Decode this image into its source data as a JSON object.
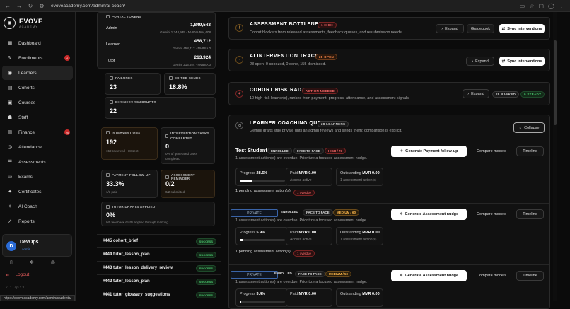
{
  "browser": {
    "url": "evoveacademy.com/admin/ai-coach/",
    "status_url": "https://evoveacademy.com/admin/students/"
  },
  "brand": {
    "name": "EVOVE",
    "sub": "ACADEMY"
  },
  "nav": [
    {
      "label": "Dashboard",
      "icon": "▦"
    },
    {
      "label": "Enrollments",
      "icon": "✎",
      "badge": "4"
    },
    {
      "label": "Learners",
      "icon": "◉",
      "active": true
    },
    {
      "label": "Cohorts",
      "icon": "▤"
    },
    {
      "label": "Courses",
      "icon": "▣"
    },
    {
      "label": "Staff",
      "icon": "☗"
    },
    {
      "label": "Finance",
      "icon": "▥",
      "badge": "20"
    },
    {
      "label": "Attendance",
      "icon": "◷"
    },
    {
      "label": "Assessments",
      "icon": "☰"
    },
    {
      "label": "Exams",
      "icon": "▭"
    },
    {
      "label": "Certificates",
      "icon": "✦"
    },
    {
      "label": "AI Coach",
      "icon": "✧"
    },
    {
      "label": "Reports",
      "icon": "↗"
    }
  ],
  "user": {
    "initial": "D",
    "name": "DevOps",
    "role": "admin"
  },
  "logout": "Logout",
  "version": "v1.1 · api 2.3",
  "tokens": {
    "label": "PORTAL TOKENS",
    "rows": [
      {
        "name": "Admin",
        "num": "1,849,543",
        "sub": "Gemini 1,344,935 · NVIDIA 504,608"
      },
      {
        "name": "Learner",
        "num": "458,712",
        "sub": "Gemini 458,712 · NVIDIA 0"
      },
      {
        "name": "Tutor",
        "num": "213,924",
        "sub": "Gemini 213,924 · NVIDIA 0"
      }
    ]
  },
  "stats": {
    "failures": {
      "label": "FAILURES",
      "value": "23"
    },
    "edited": {
      "label": "EDITED SENDS",
      "value": "18.8%"
    },
    "snapshots": {
      "label": "BUSINESS SNAPSHOTS",
      "value": "22"
    },
    "interventions": {
      "label": "INTERVENTIONS",
      "value": "192",
      "sub": "159 reviewed · 18 sent"
    },
    "tasks": {
      "label": "INTERVENTION TASKS COMPLETED",
      "value": "0",
      "sub": "0% of generated tasks completed"
    },
    "payment": {
      "label": "PAYMENT FOLLOW-UP",
      "value": "33.3%",
      "sub": "1/3 paid"
    },
    "reminder": {
      "label": "ASSESSMENT REMINDER",
      "value": "0/2",
      "sub": "0/2 submitted"
    },
    "tutor": {
      "label": "TUTOR DRAFTS APPLIED",
      "value": "0%",
      "sub": "0/0 feedback drafts applied through marking"
    }
  },
  "jobs": [
    {
      "name": "#445 cohort_brief",
      "status": "SUCCESS"
    },
    {
      "name": "#444 tutor_lesson_plan",
      "status": "SUCCESS"
    },
    {
      "name": "#443 tutor_lesson_delivery_review",
      "status": "SUCCESS"
    },
    {
      "name": "#442 tutor_lesson_plan",
      "status": "SUCCESS"
    },
    {
      "name": "#441 tutor_glossary_suggestions",
      "status": "SUCCESS"
    }
  ],
  "panels": {
    "bottlenecks": {
      "title": "ASSESSMENT BOTTLENECKS",
      "pill": "1 HIGH",
      "desc": "Cohort blockers from released assessments, feedback queues, and resubmission needs.",
      "expand": "Expand",
      "gradebook": "Gradebook",
      "sync": "Sync interventions"
    },
    "tracker": {
      "title": "AI INTERVENTION TRACKER",
      "pill": "28 OPEN",
      "desc": "28 open, 0 snoozed, 0 done, 155 dismissed.",
      "expand": "Expand",
      "sync": "Sync interventions"
    },
    "radar": {
      "title": "COHORT RISK RADAR",
      "pill": "ACTION NEEDED",
      "desc": "10 high-risk learner(s), ranked from payment, progress, attendance, and assessment signals.",
      "expand": "Expand",
      "ranked": "28 RANKED",
      "steady": "0 STEADY"
    },
    "queue": {
      "title": "LEARNER COACHING QUEUE",
      "pill": "28 LEARNERS",
      "desc": "Gemini drafts stay private until an admin reviews and sends them; comparison is explicit.",
      "collapse": "Collapse"
    }
  },
  "students": [
    {
      "name": "Test Student",
      "tags": [
        "ENROLLED",
        "FACE TO FACE",
        "HIGH / 73"
      ],
      "desc": "1 assessment action(s) are overdue. Prioritize a focused assessment nudge.",
      "generate": "Generate Payment follow-up",
      "compare": "Compare models",
      "timeline": "Timeline",
      "progress": "28.6%",
      "progress_value": 28.6,
      "paid": "MVR 0.00",
      "paid_sub": "Access active",
      "outstanding": "MVR 0.00",
      "outstanding_sub": "1 assessment action(s)",
      "pending": "1 pending assessment action(s)",
      "overdue": "1 overdue"
    },
    {
      "private": "PRIVATE",
      "tags": [
        "ENROLLED",
        "FACE TO FACE",
        "MEDIUM / 60"
      ],
      "desc": "1 assessment action(s) are overdue. Prioritize a focused assessment nudge.",
      "generate": "Generate Assessment nudge",
      "compare": "Compare models",
      "timeline": "Timeline",
      "progress": "5.9%",
      "progress_value": 5.9,
      "paid": "MVR 0.00",
      "paid_sub": "Access active",
      "outstanding": "MVR 0.00",
      "outstanding_sub": "1 assessment action(s)",
      "pending": "1 pending assessment action(s)",
      "overdue": "1 overdue"
    },
    {
      "private": "PRIVATE",
      "tags": [
        "ENROLLED",
        "FACE TO FACE",
        "MEDIUM / 50"
      ],
      "desc": "1 assessment action(s) are overdue. Prioritize a focused assessment nudge.",
      "generate": "Generate Assessment nudge",
      "compare": "Compare models",
      "timeline": "Timeline",
      "progress": "3.4%",
      "progress_value": 3.4,
      "paid": "MVR 0.00",
      "outstanding": "MVR 0.00"
    }
  ]
}
